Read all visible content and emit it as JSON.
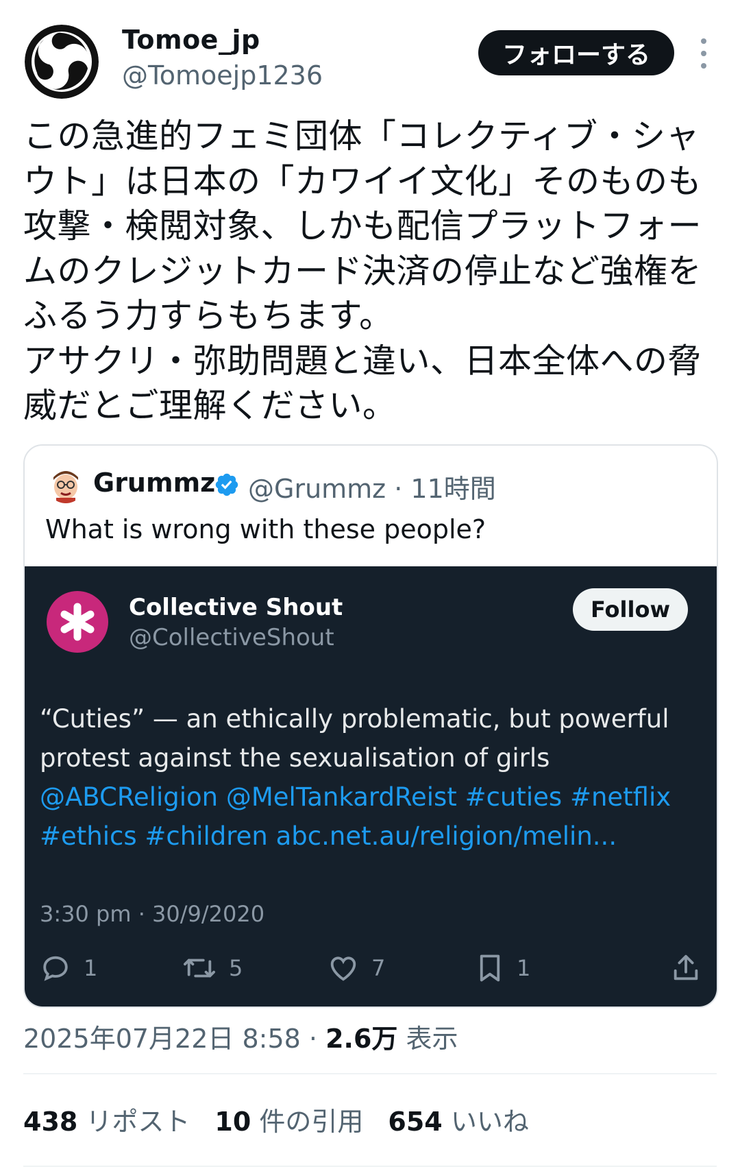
{
  "author": {
    "display_name": "Tomoe_jp",
    "handle": "@Tomoejp1236",
    "avatar_icon": "tomoe-crest-icon",
    "follow_label": "フォローする",
    "more_icon": "more-vertical-icon"
  },
  "tweet": {
    "text": "この急進的フェミ団体「コレクティブ・シャウト」は日本の「カワイイ文化」そのものも攻撃・検閲対象、しかも配信プラットフォームのクレジットカード決済の停止など強権をふるう力すらもちます。\nアサクリ・弥助問題と違い、日本全体への脅威だとご理解ください。"
  },
  "quote": {
    "name": "Grummz",
    "handle": "@Grummz",
    "time": "· 11時間",
    "verified_icon": "verified-badge-icon",
    "text": "What is wrong with these people?"
  },
  "embed": {
    "name": "Collective Shout",
    "handle": "@CollectiveShout",
    "follow_label": "Follow",
    "text_plain": "“Cuties” — an ethically problematic, but powerful protest against the sexualisation of girls",
    "text_links": "@ABCReligion @MelTankardReist #cuties #netflix #ethics #children abc.net.au/religion/melin...",
    "timestamp": "3:30 pm · 30/9/2020",
    "actions": {
      "reply": "1",
      "retweet": "5",
      "like": "7",
      "bookmark": "1"
    },
    "colors": {
      "background": "#15202b",
      "link": "#1d9bf0",
      "logo": "#c8287b"
    }
  },
  "meta": {
    "datetime": "2025年07月22日 8:58 · ",
    "views_count": "2.6万",
    "views_label": " 表示"
  },
  "stats": {
    "reposts_count": "438",
    "reposts_label": " リポスト",
    "quotes_count": "10",
    "quotes_label": " 件の引用",
    "likes_count": "654",
    "likes_label": " いいね"
  }
}
